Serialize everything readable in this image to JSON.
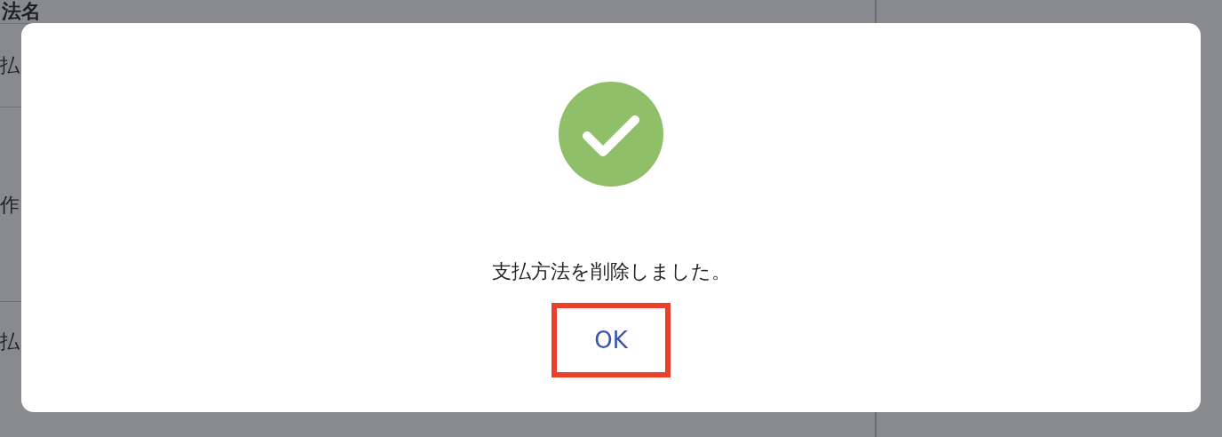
{
  "background_table": {
    "header": "法名",
    "rows": [
      {
        "cell": "払"
      },
      {
        "cell": "作"
      },
      {
        "cell": "払"
      }
    ]
  },
  "dialog": {
    "success": true,
    "message": "支払方法を削除しました。",
    "button": "OK",
    "button_highlighted": true
  }
}
